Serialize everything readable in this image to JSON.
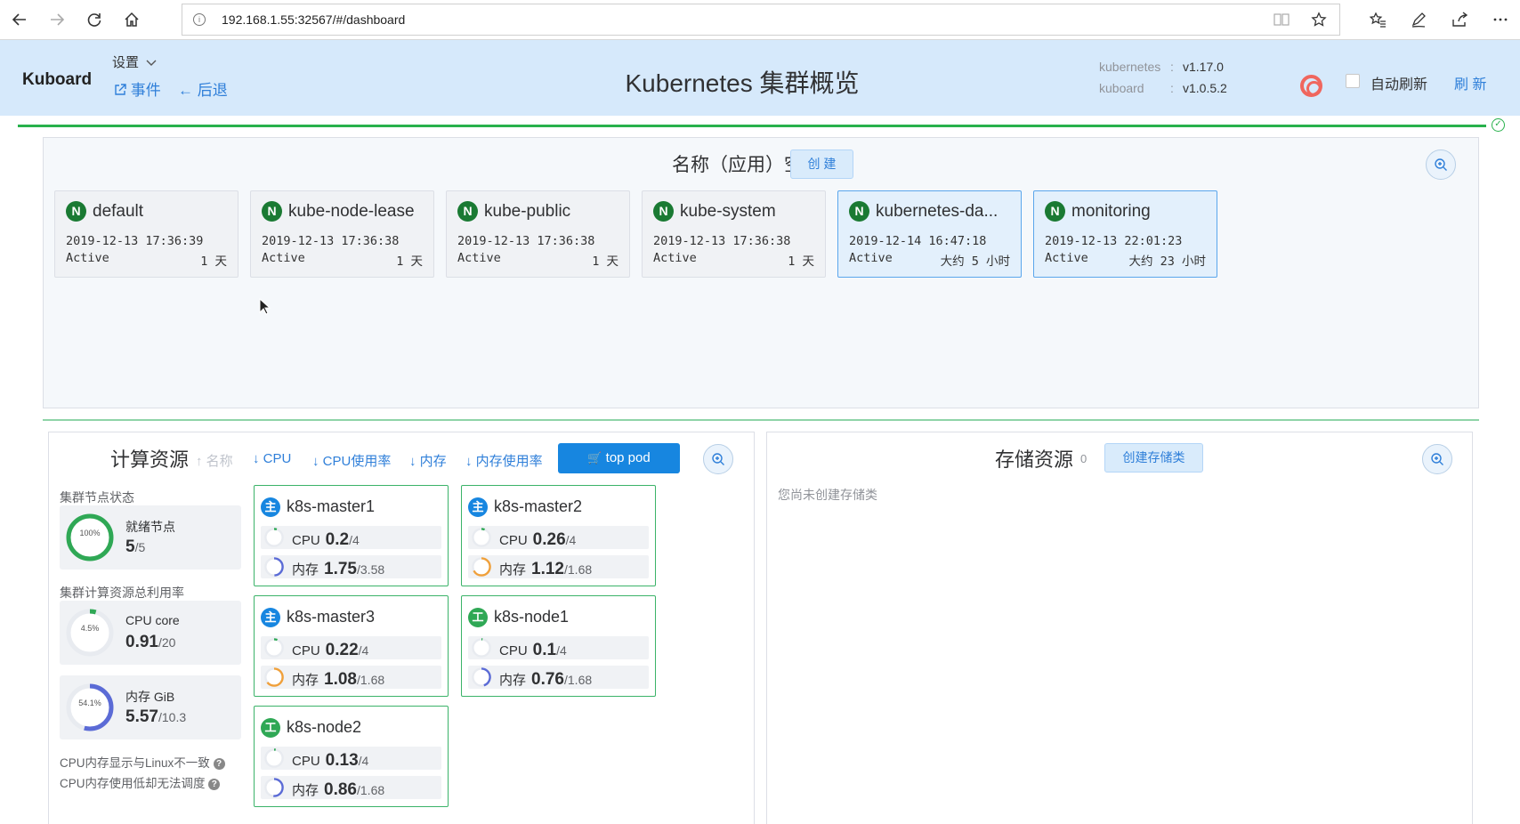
{
  "browser": {
    "url": "192.168.1.55:32567/#/dashboard"
  },
  "header": {
    "brand": "Kuboard",
    "settings": "设置",
    "events": "事件",
    "back": "后退",
    "title": "Kubernetes 集群概览",
    "versions": [
      {
        "name": "kubernetes",
        "sep": ":",
        "value": "v1.17.0"
      },
      {
        "name": "kuboard",
        "sep": ":",
        "value": "v1.0.5.2"
      }
    ],
    "auto_refresh_label": "自动刷新",
    "refresh_label": "刷 新"
  },
  "namespaces": {
    "title": "名称（应用）空间",
    "create_label": "创 建",
    "badge": "N",
    "items": [
      {
        "name": "default",
        "created": "2019-12-13 17:36:39",
        "status": "Active",
        "age": "1 天",
        "selected": false
      },
      {
        "name": "kube-node-lease",
        "created": "2019-12-13 17:36:38",
        "status": "Active",
        "age": "1 天",
        "selected": false
      },
      {
        "name": "kube-public",
        "created": "2019-12-13 17:36:38",
        "status": "Active",
        "age": "1 天",
        "selected": false
      },
      {
        "name": "kube-system",
        "created": "2019-12-13 17:36:38",
        "status": "Active",
        "age": "1 天",
        "selected": false
      },
      {
        "name": "kubernetes-da...",
        "created": "2019-12-14 16:47:18",
        "status": "Active",
        "age": "大约 5 小时",
        "selected": true
      },
      {
        "name": "monitoring",
        "created": "2019-12-13 22:01:23",
        "status": "Active",
        "age": "大约 23 小时",
        "selected": true
      }
    ]
  },
  "compute": {
    "title": "计算资源",
    "sort_options": [
      "↑ 名称",
      "↓ CPU",
      "↓ CPU使用率",
      "↓ 内存",
      "↓ 内存使用率"
    ],
    "top_pod_label": "top pod",
    "node_status_label": "集群节点状态",
    "ready_nodes": {
      "label": "就绪节点",
      "value": "5",
      "total": "/5",
      "percent_text": "100%",
      "fraction": 1.0
    },
    "utilization_label": "集群计算资源总利用率",
    "cpu_total": {
      "label": "CPU core",
      "value": "0.91",
      "total": "/20",
      "percent_text": "4.5%",
      "fraction": 0.045
    },
    "mem_total": {
      "label": "内存 GiB",
      "value": "5.57",
      "total": "/10.3",
      "percent_text": "54.1%",
      "fraction": 0.541
    },
    "notes": [
      "CPU内存显示与Linux不一致",
      "CPU内存使用低却无法调度"
    ],
    "cpu_label": "CPU",
    "mem_label": "内存",
    "nodes": [
      {
        "name": "k8s-master1",
        "role": "主",
        "type": "master",
        "cpu": "0.2",
        "cpu_total": "/4",
        "cpu_pct": "5%",
        "cpu_frac": 0.05,
        "mem": "1.75",
        "mem_total": "/3.58",
        "mem_pct": "49%",
        "mem_frac": 0.49
      },
      {
        "name": "k8s-master2",
        "role": "主",
        "type": "master",
        "cpu": "0.26",
        "cpu_total": "/4",
        "cpu_pct": "6%",
        "cpu_frac": 0.06,
        "mem": "1.12",
        "mem_total": "/1.68",
        "mem_pct": "67%",
        "mem_frac": 0.67
      },
      {
        "name": "k8s-master3",
        "role": "主",
        "type": "master",
        "cpu": "0.22",
        "cpu_total": "/4",
        "cpu_pct": "6%",
        "cpu_frac": 0.06,
        "mem": "1.08",
        "mem_total": "/1.68",
        "mem_pct": "64%",
        "mem_frac": 0.64
      },
      {
        "name": "k8s-node1",
        "role": "工",
        "type": "worker",
        "cpu": "0.1",
        "cpu_total": "/4",
        "cpu_pct": "2%",
        "cpu_frac": 0.02,
        "mem": "0.76",
        "mem_total": "/1.68",
        "mem_pct": "45%",
        "mem_frac": 0.45
      },
      {
        "name": "k8s-node2",
        "role": "工",
        "type": "worker",
        "cpu": "0.13",
        "cpu_total": "/4",
        "cpu_pct": "3%",
        "cpu_frac": 0.03,
        "mem": "0.86",
        "mem_total": "/1.68",
        "mem_pct": "51%",
        "mem_frac": 0.51
      }
    ]
  },
  "storage": {
    "title": "存储资源",
    "count": "0",
    "create_label": "创建存储类",
    "empty_text": "您尚未创建存储类"
  },
  "colors": {
    "accent": "#1786e0",
    "header_bg": "#d6e9fb",
    "ring_ok": "#2fa855",
    "ring_low": "#5b6bd6",
    "ring_warn": "#f0a03a",
    "namespace_badge": "#1a7a33"
  }
}
